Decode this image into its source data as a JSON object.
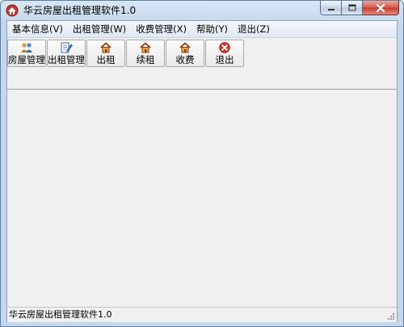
{
  "window": {
    "title": "华云房屋出租管理软件1.0"
  },
  "menu": {
    "items": [
      {
        "label": "基本信息(V)"
      },
      {
        "label": "出租管理(W)"
      },
      {
        "label": "收费管理(X)"
      },
      {
        "label": "帮助(Y)"
      },
      {
        "label": "退出(Z)"
      }
    ]
  },
  "toolbar": {
    "buttons": [
      {
        "label": "房屋管理",
        "icon": "house-users-icon"
      },
      {
        "label": "出租管理",
        "icon": "document-edit-icon"
      },
      {
        "label": "出租",
        "icon": "house-icon"
      },
      {
        "label": "续租",
        "icon": "house-icon"
      },
      {
        "label": "收费",
        "icon": "house-icon"
      },
      {
        "label": "退出",
        "icon": "red-x-close-icon"
      }
    ]
  },
  "status": {
    "text": "华云房屋出租管理软件1.0"
  },
  "colors": {
    "close_button": "#c63a2b",
    "client_background": "#f0f0f0",
    "title_background": "#c4d7ec"
  }
}
